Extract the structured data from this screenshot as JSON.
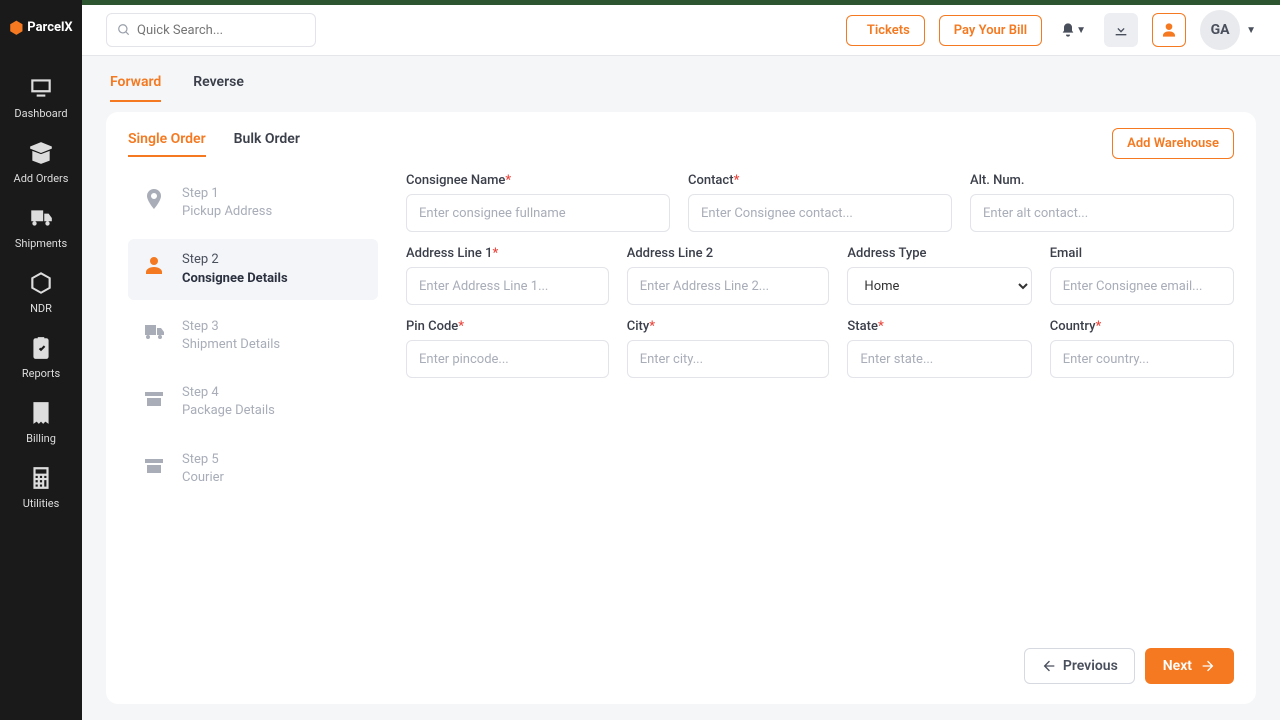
{
  "brand": "ParcelX",
  "search": {
    "placeholder": "Quick Search..."
  },
  "topbar": {
    "tickets": "Tickets",
    "payBill": "Pay Your Bill",
    "userInitials": "GA"
  },
  "sidebar": {
    "items": [
      {
        "label": "Dashboard"
      },
      {
        "label": "Add Orders"
      },
      {
        "label": "Shipments"
      },
      {
        "label": "NDR"
      },
      {
        "label": "Reports"
      },
      {
        "label": "Billing"
      },
      {
        "label": "Utilities"
      }
    ]
  },
  "topTabs": {
    "forward": "Forward",
    "reverse": "Reverse"
  },
  "innerTabs": {
    "single": "Single Order",
    "bulk": "Bulk Order"
  },
  "addWarehouse": "Add Warehouse",
  "steps": [
    {
      "label": "Step 1",
      "desc": "Pickup Address"
    },
    {
      "label": "Step 2",
      "desc": "Consignee Details"
    },
    {
      "label": "Step 3",
      "desc": "Shipment Details"
    },
    {
      "label": "Step 4",
      "desc": "Package Details"
    },
    {
      "label": "Step 5",
      "desc": "Courier"
    }
  ],
  "form": {
    "consigneeName": {
      "label": "Consignee Name",
      "placeholder": "Enter consignee fullname"
    },
    "contact": {
      "label": "Contact",
      "placeholder": "Enter Consignee contact..."
    },
    "altNum": {
      "label": "Alt. Num.",
      "placeholder": "Enter alt contact..."
    },
    "addr1": {
      "label": "Address Line 1",
      "placeholder": "Enter Address Line 1..."
    },
    "addr2": {
      "label": "Address Line 2",
      "placeholder": "Enter Address Line 2..."
    },
    "addrType": {
      "label": "Address Type",
      "value": "Home",
      "options": [
        "Home"
      ]
    },
    "email": {
      "label": "Email",
      "placeholder": "Enter Consignee email..."
    },
    "pin": {
      "label": "Pin Code",
      "placeholder": "Enter pincode..."
    },
    "city": {
      "label": "City",
      "placeholder": "Enter city..."
    },
    "state": {
      "label": "State",
      "placeholder": "Enter state..."
    },
    "country": {
      "label": "Country",
      "placeholder": "Enter country..."
    }
  },
  "buttons": {
    "previous": "Previous",
    "next": "Next"
  }
}
